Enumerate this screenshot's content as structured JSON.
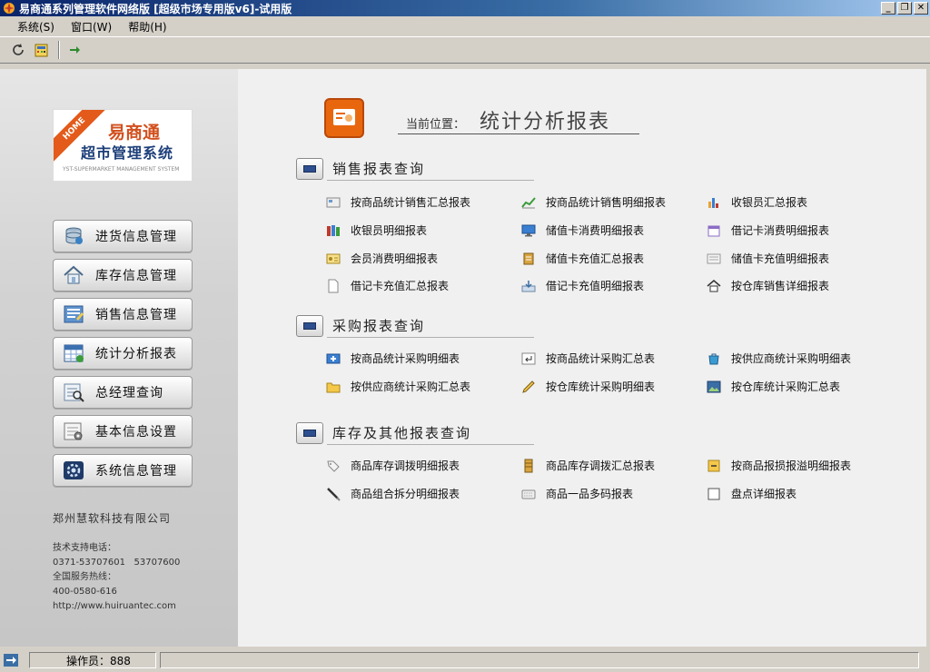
{
  "window": {
    "title": "易商通系列管理软件网络版 [超级市场专用版v6]-试用版"
  },
  "menu": [
    "系统(S)",
    "窗口(W)",
    "帮助(H)"
  ],
  "logo": {
    "ribbon": "HOME",
    "brand": "易商通",
    "system": "超市管理系统",
    "english": "YST-SUPERMARKET MANAGEMENT SYSTEM"
  },
  "nav": [
    {
      "label": "进货信息管理",
      "icon": "database-icon"
    },
    {
      "label": "库存信息管理",
      "icon": "house-icon"
    },
    {
      "label": "销售信息管理",
      "icon": "document-edit-icon"
    },
    {
      "label": "统计分析报表",
      "icon": "spreadsheet-icon"
    },
    {
      "label": "总经理查询",
      "icon": "magnifier-report-icon"
    },
    {
      "label": "基本信息设置",
      "icon": "settings-doc-icon"
    },
    {
      "label": "系统信息管理",
      "icon": "system-gear-icon"
    }
  ],
  "company": "郑州慧软科技有限公司",
  "contact": [
    "技术支持电话：",
    "0371-53707601   53707600",
    "全国服务热线：",
    "400-0580-616",
    "http://www.huiruantec.com"
  ],
  "location": {
    "label": "当前位置：",
    "value": "统计分析报表"
  },
  "sections": [
    {
      "title": "销售报表查询",
      "items": [
        "按商品统计销售汇总报表",
        "按商品统计销售明细报表",
        "收银员汇总报表",
        "收银员明细报表",
        "储值卡消费明细报表",
        "借记卡消费明细报表",
        "会员消费明细报表",
        "储值卡充值汇总报表",
        "储值卡充值明细报表",
        "借记卡充值汇总报表",
        "借记卡充值明细报表",
        "按仓库销售详细报表"
      ]
    },
    {
      "title": "采购报表查询",
      "items": [
        "按商品统计采购明细表",
        "按商品统计采购汇总表",
        "按供应商统计采购明细表",
        "按供应商统计采购汇总表",
        "按仓库统计采购明细表",
        "按仓库统计采购汇总表"
      ]
    },
    {
      "title": "库存及其他报表查询",
      "items": [
        "商品库存调拨明细报表",
        "商品库存调拨汇总报表",
        "按商品报损报溢明细报表",
        "商品组合拆分明细报表",
        "商品一品多码报表",
        "盘点详细报表"
      ]
    }
  ],
  "status": {
    "operator": "操作员：888"
  }
}
